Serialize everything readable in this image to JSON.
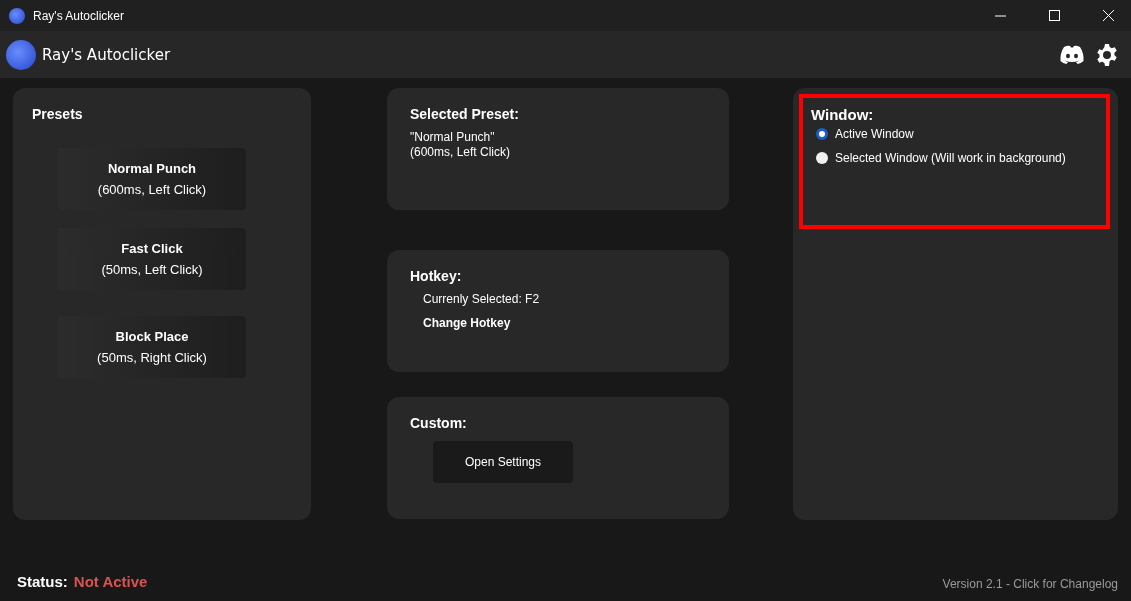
{
  "window": {
    "title": "Ray's Autoclicker"
  },
  "header": {
    "title": "Ray's Autoclicker"
  },
  "presets": {
    "title": "Presets",
    "items": [
      {
        "name": "Normal Punch",
        "detail": "(600ms, Left Click)"
      },
      {
        "name": "Fast Click",
        "detail": "(50ms, Left Click)"
      },
      {
        "name": "Block Place",
        "detail": "(50ms, Right Click)"
      }
    ]
  },
  "selected_preset": {
    "title": "Selected Preset:",
    "name": "\"Normal Punch\"",
    "detail": "(600ms, Left Click)"
  },
  "hotkey": {
    "title": "Hotkey:",
    "current": "Currenly Selected: F2",
    "button": "Change Hotkey"
  },
  "custom": {
    "title": "Custom:",
    "button": "Open Settings"
  },
  "window_mode": {
    "title": "Window:",
    "highlighted": true,
    "options": [
      {
        "label": "Active Window",
        "selected": true
      },
      {
        "label": "Selected Window (Will work in background)",
        "selected": false
      }
    ]
  },
  "status": {
    "label": "Status:",
    "value": "Not Active",
    "active": false
  },
  "version": "Version 2.1 - Click for Changelog"
}
